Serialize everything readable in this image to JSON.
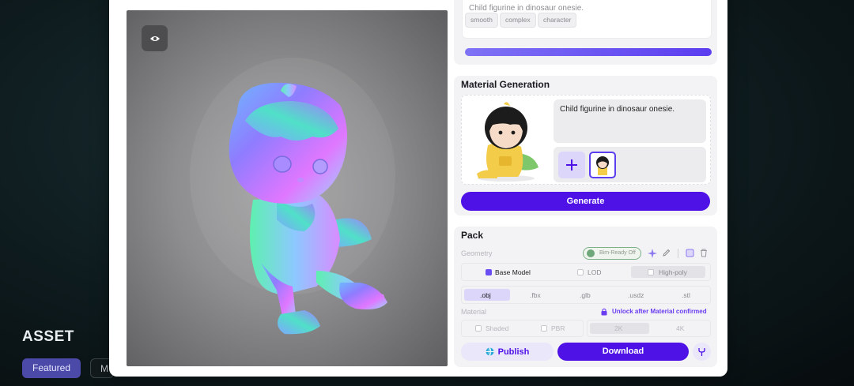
{
  "background": {
    "section_title": "ASSET",
    "filters": [
      "Featured",
      "M"
    ]
  },
  "top_prompt": {
    "text": "Child figurine in dinosaur onesie.",
    "tags": [
      "smooth",
      "complex",
      "character"
    ]
  },
  "material_generation": {
    "title": "Material Generation",
    "prompt": "Child figurine in dinosaur onesie.",
    "generate_label": "Generate"
  },
  "pack": {
    "title": "Pack",
    "geometry_label": "Geometry",
    "badge_text": "Bim-Ready Off",
    "geometry_options": [
      "Base Model",
      "LOD",
      "High-poly"
    ],
    "formats": [
      ".obj",
      ".fbx",
      ".glb",
      ".usdz",
      ".stl"
    ],
    "material_label": "Material",
    "unlock_text": "Unlock after Material confirmed",
    "material_options": [
      "Shaded",
      "PBR"
    ],
    "resolutions": [
      "2K",
      "4K"
    ],
    "publish_label": "Publish",
    "download_label": "Download"
  },
  "colors": {
    "accent": "#4f12e6",
    "accent_light": "#ebe7fb",
    "progress": "#5b3df0"
  },
  "icons": [
    "eye-icon",
    "plus-icon",
    "edit-icon",
    "sparkle-icon",
    "trash-icon",
    "frame-icon",
    "globe-icon",
    "fork-icon",
    "lock-icon"
  ]
}
